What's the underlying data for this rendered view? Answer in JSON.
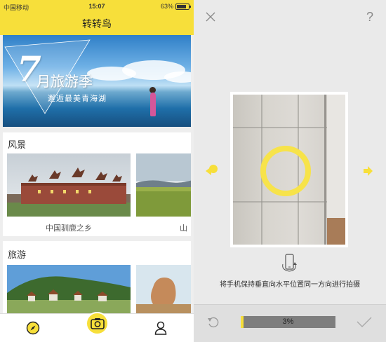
{
  "left_app": {
    "status_bar": {
      "carrier": "中国移动",
      "time": "15:07",
      "battery_percent": "63%"
    },
    "title": "转转鸟",
    "banner": {
      "big_number": "7",
      "headline": "月旅游季",
      "subtitle": "邂逅最美青海湖",
      "dots_total": 3,
      "dot_active": 0
    },
    "sections": [
      {
        "title": "风景",
        "cards": [
          {
            "caption": "中国驯鹿之乡"
          },
          {
            "caption": "山"
          }
        ]
      },
      {
        "title": "旅游",
        "cards": [
          {
            "caption": ""
          },
          {
            "caption": ""
          }
        ]
      }
    ],
    "tabbar": {
      "left_icon": "compass-icon",
      "center_icon": "camera-icon",
      "right_icon": "user-icon"
    },
    "colors": {
      "accent": "#f7df3a",
      "background": "#eeeeee"
    }
  },
  "right_app": {
    "hint": "将手机保持垂直向水平位置同一方向进行拍摄",
    "progress": {
      "value": 0.03,
      "label": "3%"
    },
    "icons": {
      "close": "close-icon",
      "help": "?",
      "left_arrow": "arrow-left-icon",
      "right_arrow": "arrow-right-icon",
      "rotate_phone": "phone-rotate-icon",
      "undo": "undo-icon",
      "confirm": "check-icon"
    },
    "colors": {
      "accent": "#f7df3a",
      "ring": "#f7e34a",
      "bottom_bar": "#dfdfdf"
    }
  }
}
